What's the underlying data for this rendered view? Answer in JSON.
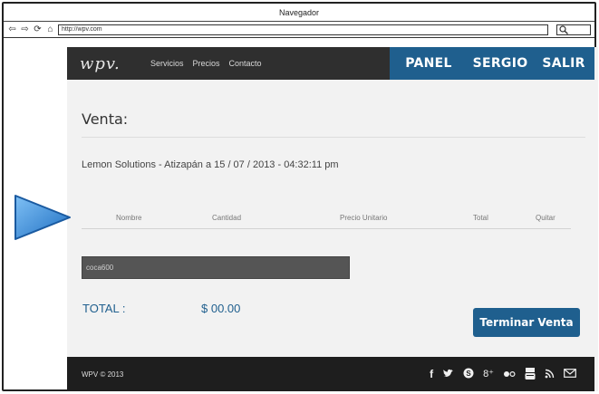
{
  "browser": {
    "title": "Navegador",
    "url": "http://wpv.com"
  },
  "nav": {
    "logo": "wpv.",
    "links": [
      "Servicios",
      "Precios",
      "Contacto"
    ],
    "panel": "PANEL",
    "user": "SERGIO",
    "logout": "SALIR"
  },
  "sale": {
    "heading": "Venta:",
    "meta": "Lemon Solutions - Atizapán a 15 / 07 / 2013 - 04:32:11 pm",
    "columns": [
      "Nombre",
      "Cantidad",
      "Precio Unitario",
      "Total",
      "Quitar"
    ],
    "input_value": "coca600",
    "total_label": "TOTAL :",
    "total_value": "$ 00.00",
    "finish_label": "Terminar Venta"
  },
  "footer": {
    "copyright": "WPV © 2013",
    "social_icons": [
      "facebook-icon",
      "twitter-icon",
      "skype-icon",
      "google-plus-icon",
      "flickr-icon",
      "youtube-icon",
      "rss-icon",
      "mail-icon"
    ]
  },
  "colors": {
    "accent": "#1f5f8e",
    "topnav": "#2f2f2f",
    "footer": "#1e1e1e",
    "page_bg": "#f2f2f2",
    "pointer": "#2f86d8"
  }
}
